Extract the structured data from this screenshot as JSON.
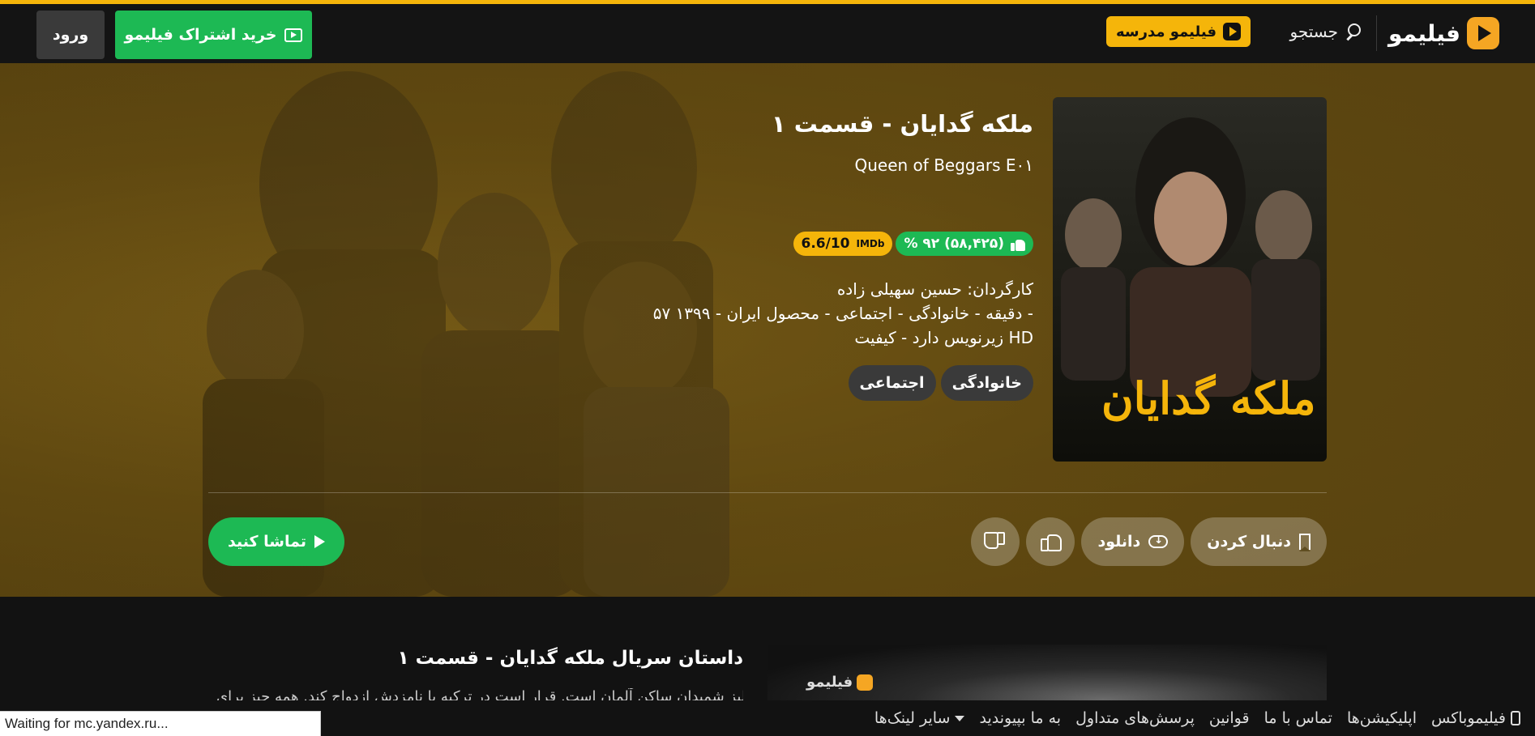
{
  "header": {
    "logo_text": "فیلیمو",
    "search_label": "جستجو",
    "school_label": "فیلیمو مدرسه",
    "buy_label": "خرید اشتراک فیلیمو",
    "login_label": "ورود"
  },
  "movie": {
    "title": "ملکه گدایان - قسمت ۱",
    "subtitle": "Queen of Beggars E۰۱",
    "poster_title": "ملکه گدایان",
    "like_value": "(۵۸,۴۲۵)  ۹۲ %",
    "imdb_label": "IMDb",
    "imdb_value": "6.6/10",
    "director": "کارگردان: حسین سهیلی زاده",
    "info": "۵۷ دقیقه - خانوادگی - اجتماعی - محصول ایران - ۱۳۹۹ -",
    "quality": "زیرنویس دارد - کیفیت HD",
    "tags": [
      "خانوادگی",
      "اجتماعی"
    ]
  },
  "actions": {
    "follow_label": "دنبال کردن",
    "download_label": "دانلود",
    "watch_label": "تماشا کنید"
  },
  "story": {
    "title": "داستان سریال ملکه گدایان - قسمت ۱",
    "text": "البز شمیدان ساکن آلمان است. قرار است در ترکیه با نامزدش ازدواج کند. همه چیز برای"
  },
  "video": {
    "logo_text": "فیلیمو"
  },
  "footer": {
    "items": [
      "فیلیموباکس",
      "اپلیکیشن‌ها",
      "تماس با ما",
      "قوانین",
      "پرسش‌های متداول",
      "به ما بپیوندید",
      "سایر لینک‌ها"
    ]
  },
  "status": {
    "text": "Waiting for mc.yandex.ru..."
  },
  "colors": {
    "accent_yellow": "#f5b50a",
    "accent_green": "#1db954",
    "background": "#121212"
  }
}
